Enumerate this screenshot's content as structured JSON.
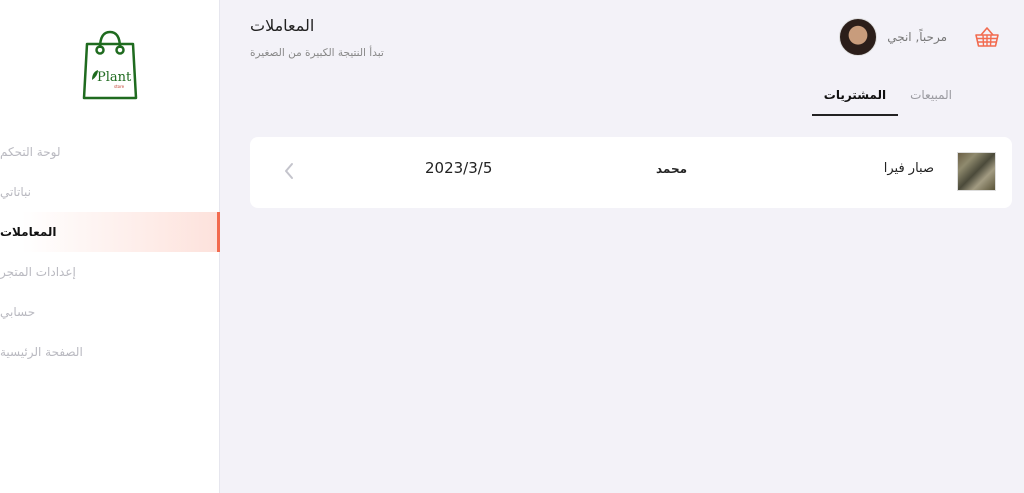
{
  "sidebar": {
    "logo_text": "Plant",
    "logo_sub": "store",
    "items": [
      {
        "label": "لوحة التحكم"
      },
      {
        "label": "نباتاتي"
      },
      {
        "label": "المعاملات"
      },
      {
        "label": "إعدادات المتجر"
      },
      {
        "label": "حسابي"
      },
      {
        "label": "الصفحة الرئيسية"
      }
    ]
  },
  "header": {
    "title": "المعاملات",
    "subtitle": "تبدأ النتيجة الكبيرة من الصغيرة",
    "greeting": "مرحباً, انجي"
  },
  "tabs": [
    {
      "label": "المبيعات"
    },
    {
      "label": "المشتريات"
    }
  ],
  "transactions": [
    {
      "product": "صبار فيرا",
      "person": "محمد",
      "date": "2023/3/5"
    }
  ],
  "colors": {
    "accent": "#f26b4f",
    "brand_green": "#1f6b1f",
    "background": "#f3f2f8"
  }
}
